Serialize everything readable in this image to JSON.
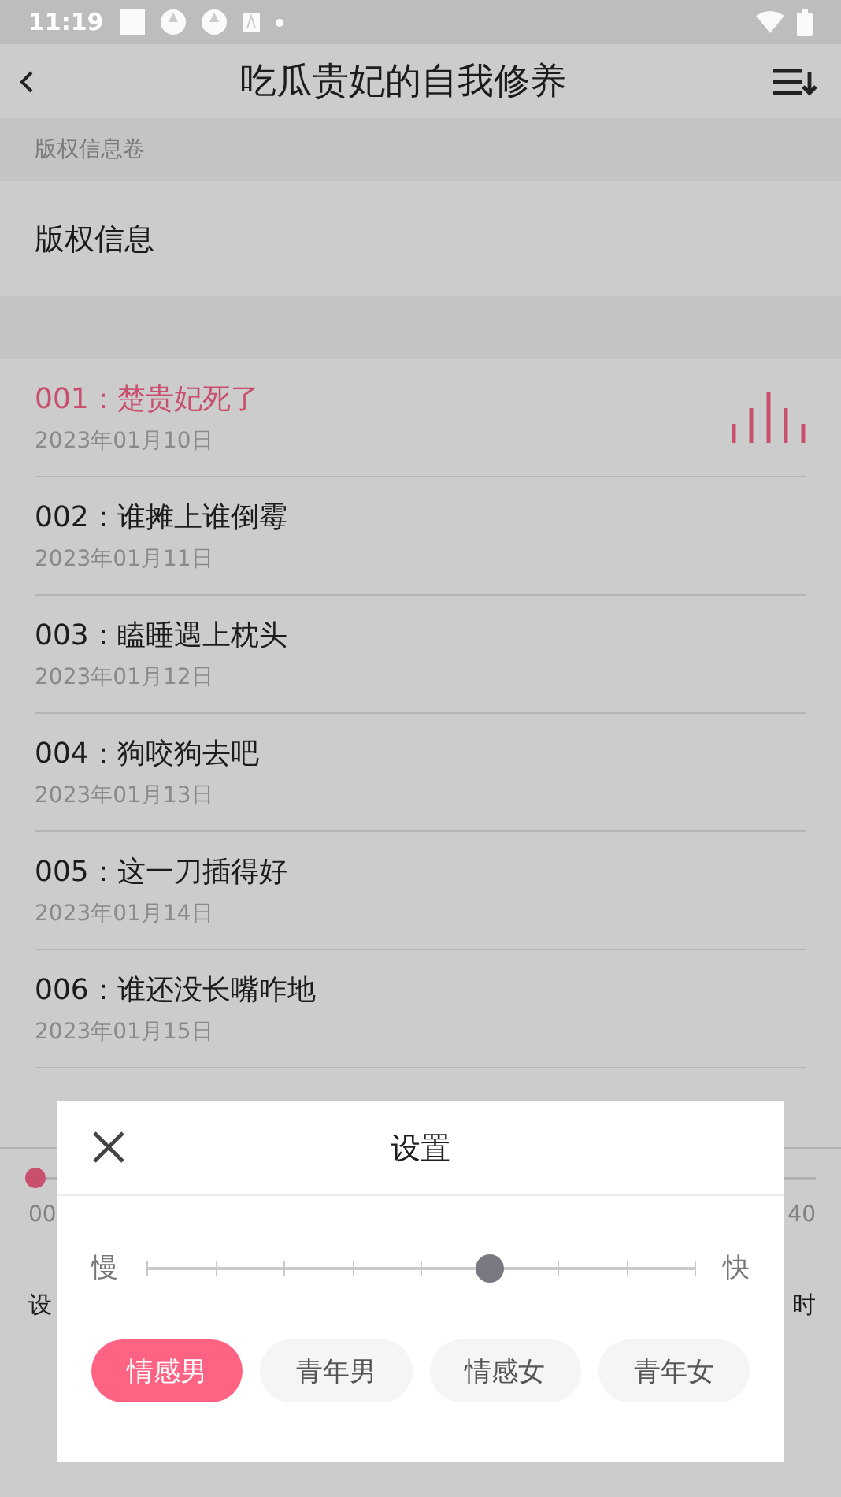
{
  "status_bar": {
    "time": "11:19"
  },
  "header": {
    "title": "吃瓜贵妃的自我修养"
  },
  "volume": {
    "label": "版权信息卷",
    "items": [
      {
        "title": "版权信息"
      }
    ]
  },
  "chapters": [
    {
      "title": "001：楚贵妃死了",
      "date": "2023年01月10日",
      "selected": true
    },
    {
      "title": "002：谁摊上谁倒霉",
      "date": "2023年01月11日",
      "selected": false
    },
    {
      "title": "003：瞌睡遇上枕头",
      "date": "2023年01月12日",
      "selected": false
    },
    {
      "title": "004：狗咬狗去吧",
      "date": "2023年01月13日",
      "selected": false
    },
    {
      "title": "005：这一刀插得好",
      "date": "2023年01月14日",
      "selected": false
    },
    {
      "title": "006：谁还没长嘴咋地",
      "date": "2023年01月15日",
      "selected": false
    }
  ],
  "player": {
    "level": 0,
    "time_start": "00",
    "time_end": "40",
    "left_label": "设",
    "right_label": "时"
  },
  "dialog": {
    "title": "设置",
    "speed": {
      "slow": "慢",
      "fast": "快",
      "level": 0.625
    },
    "voices": [
      {
        "label": "情感男",
        "selected": true
      },
      {
        "label": "青年男",
        "selected": false
      },
      {
        "label": "情感女",
        "selected": false
      },
      {
        "label": "青年女",
        "selected": false
      }
    ]
  }
}
